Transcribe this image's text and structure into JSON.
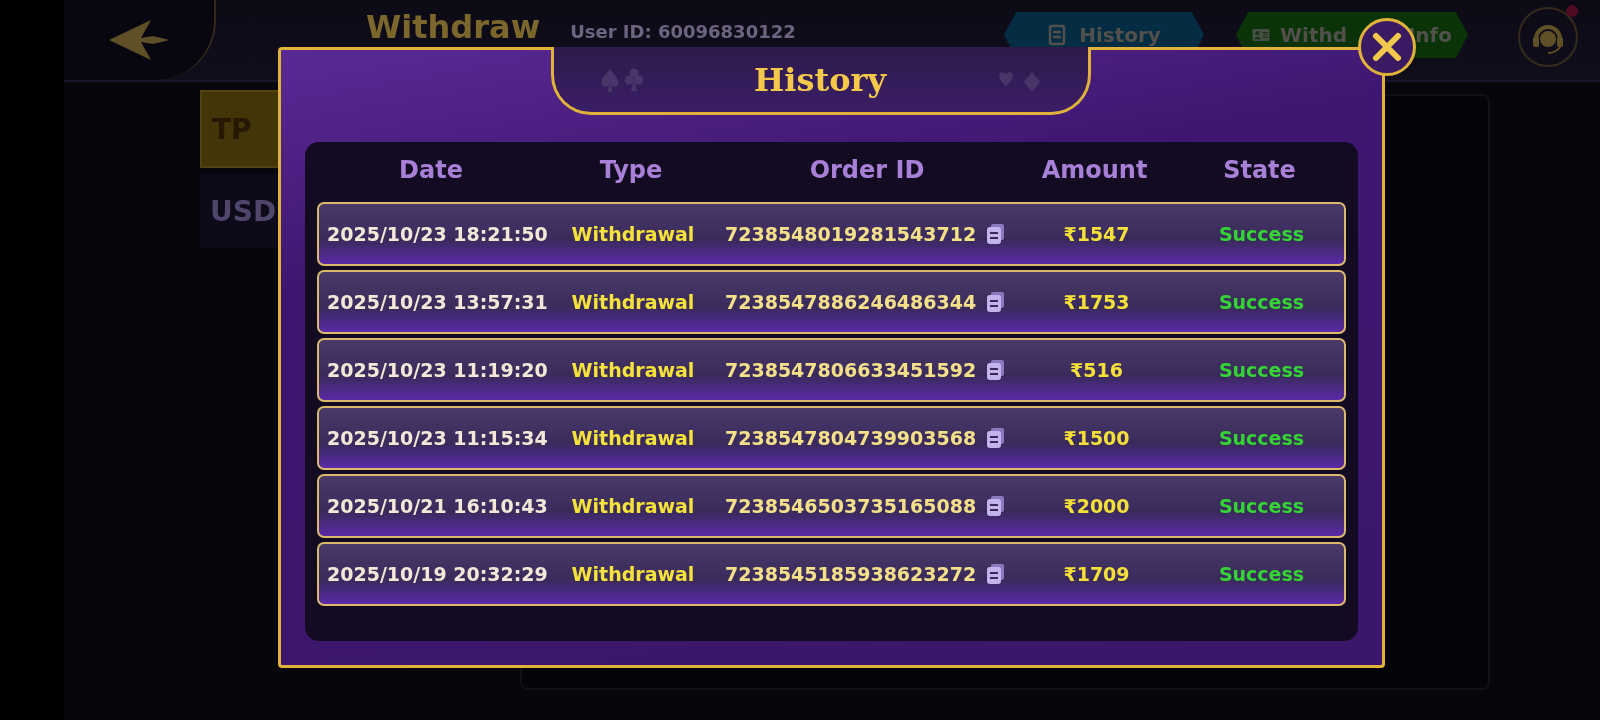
{
  "top_bar": {
    "title": "Withdraw",
    "user_id": "User ID: 60096830122",
    "history_tab": "History",
    "info_tab_start": "Withd",
    "info_tab_end": "Info"
  },
  "side_options": [
    {
      "label": "TP",
      "selected": true
    },
    {
      "label": "USD",
      "selected": false
    }
  ],
  "history_dialog": {
    "title": "History",
    "columns": [
      "Date",
      "Type",
      "Order ID",
      "Amount",
      "State"
    ],
    "rows": [
      {
        "date": "2025/10/23 18:21:50",
        "type": "Withdrawal",
        "order_id": "7238548019281543712",
        "amount": "₹1547",
        "state": "Success"
      },
      {
        "date": "2025/10/23 13:57:31",
        "type": "Withdrawal",
        "order_id": "7238547886246486344",
        "amount": "₹1753",
        "state": "Success"
      },
      {
        "date": "2025/10/23 11:19:20",
        "type": "Withdrawal",
        "order_id": "7238547806633451592",
        "amount": "₹516",
        "state": "Success"
      },
      {
        "date": "2025/10/23 11:15:34",
        "type": "Withdrawal",
        "order_id": "7238547804739903568",
        "amount": "₹1500",
        "state": "Success"
      },
      {
        "date": "2025/10/21 16:10:43",
        "type": "Withdrawal",
        "order_id": "7238546503735165088",
        "amount": "₹2000",
        "state": "Success"
      },
      {
        "date": "2025/10/19 20:32:29",
        "type": "Withdrawal",
        "order_id": "7238545185938623272",
        "amount": "₹1709",
        "state": "Success"
      }
    ]
  }
}
